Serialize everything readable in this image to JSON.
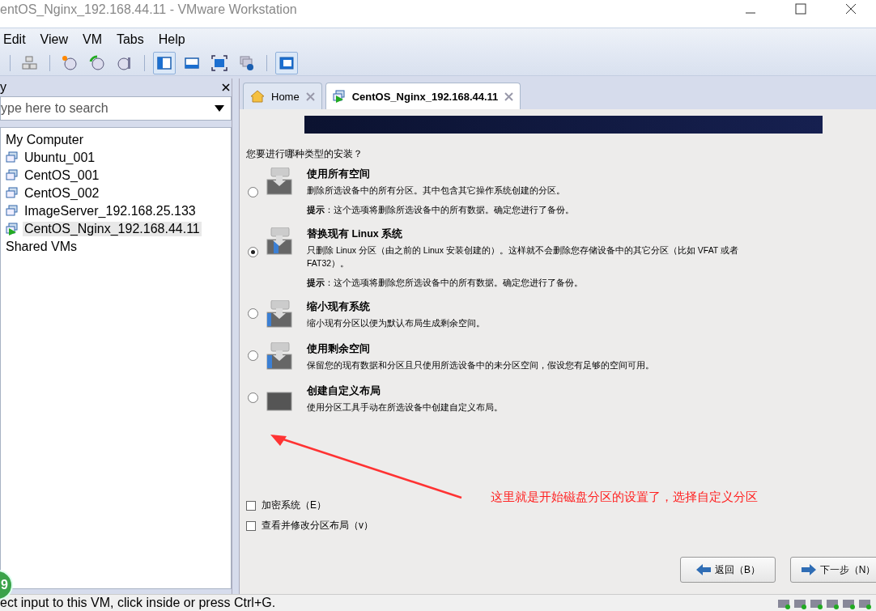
{
  "window": {
    "title": "entOS_Nginx_192.168.44.11 - VMware Workstation"
  },
  "menu": [
    "Edit",
    "View",
    "VM",
    "Tabs",
    "Help"
  ],
  "toolbar": [
    {
      "kind": "sep"
    },
    {
      "kind": "button",
      "selected": false
    },
    {
      "kind": "sep"
    },
    {
      "kind": "button",
      "selected": false
    },
    {
      "kind": "button",
      "selected": false
    },
    {
      "kind": "button",
      "selected": false
    },
    {
      "kind": "sep"
    },
    {
      "kind": "button",
      "selected": true
    },
    {
      "kind": "button",
      "selected": false
    },
    {
      "kind": "button",
      "selected": false
    },
    {
      "kind": "button",
      "selected": false
    },
    {
      "kind": "sep"
    },
    {
      "kind": "button",
      "selected": true
    }
  ],
  "library": {
    "title": "y",
    "search": {
      "placeholder": "ype here to search"
    },
    "tree": [
      {
        "label": "My Computer",
        "kind": "folder",
        "selected": false,
        "children": [
          {
            "label": "Ubuntu_001",
            "kind": "vm",
            "selected": false
          },
          {
            "label": "CentOS_001",
            "kind": "vm",
            "selected": false
          },
          {
            "label": "CentOS_002",
            "kind": "vm",
            "selected": false
          },
          {
            "label": "ImageServer_192.168.25.133",
            "kind": "vm",
            "selected": false
          },
          {
            "label": "CentOS_Nginx_192.168.44.11",
            "kind": "running",
            "selected": true
          }
        ]
      },
      {
        "label": "Shared VMs",
        "kind": "folder",
        "selected": false
      }
    ],
    "badge": "9"
  },
  "tabs": [
    {
      "label": "Home",
      "selected": false
    },
    {
      "label": "CentOS_Nginx_192.168.44.11",
      "selected": true
    }
  ],
  "installer": {
    "question": "您要进行哪种类型的安装？",
    "options": [
      {
        "title": "使用所有空间",
        "description": "删除所选设备中的所有分区。其中包含其它操作系统创建的分区。",
        "hint": "**提示**：这个选项将删除所选设备中的所有数据。确定您进行了备份。",
        "selected": false
      },
      {
        "title": "替换现有 Linux 系统",
        "description": "只删除 Linux 分区（由之前的 Linux 安装创建的）。这样就不会删除您存储设备中的其它分区（比如 VFAT 或者 FAT32）。",
        "hint": "**提示**：这个选项将删除您所选设备中的所有数据。确定您进行了备份。",
        "selected": true
      },
      {
        "title": "缩小现有系统",
        "description": "缩小现有分区以便为默认布局生成剩余空间。",
        "selected": false
      },
      {
        "title": "使用剩余空间",
        "description": "保留您的现有数据和分区且只使用所选设备中的未分区空间，假设您有足够的空间可用。",
        "selected": false
      },
      {
        "title": "创建自定义布局",
        "description": "使用分区工具手动在所选设备中创建自定义布局。",
        "selected": false
      }
    ],
    "checkboxes": [
      {
        "label": "加密系统（E）",
        "checked": false
      },
      {
        "label": "查看并修改分区布局（v）",
        "checked": false
      }
    ],
    "buttons": [
      {
        "label": "返回（B）",
        "kind": "back"
      },
      {
        "label": "下一步（N）",
        "kind": "next"
      }
    ],
    "annotation": "这里就是开始磁盘分区的设置了，选择自定义分区"
  },
  "status_bar": {
    "text": "ect input to this VM, click inside or press Ctrl+G."
  }
}
